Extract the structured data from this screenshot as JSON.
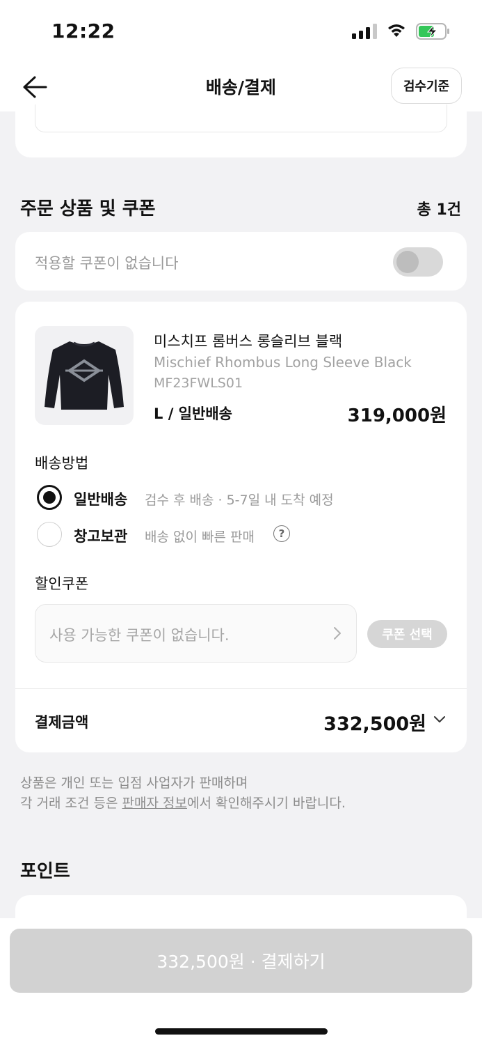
{
  "status_bar": {
    "time": "12:22"
  },
  "nav": {
    "title": "배송/결제",
    "criteria_button": "검수기준"
  },
  "order_section": {
    "title": "주문 상품 및 쿠폰",
    "count": "총 1건"
  },
  "coupon_toggle": {
    "text": "적용할 쿠폰이 없습니다",
    "enabled": false
  },
  "product": {
    "name_ko": "미스치프 롬버스 롱슬리브 블랙",
    "name_en": "Mischief Rhombus Long Sleeve Black",
    "code": "MF23FWLS01",
    "option": "L / 일반배송",
    "price": "319,000원"
  },
  "shipping": {
    "label": "배송방법",
    "options": [
      {
        "name": "일반배송",
        "desc": "검수 후 배송 · 5-7일 내 도착 예정",
        "selected": true
      },
      {
        "name": "창고보관",
        "desc": "배송 없이 빠른 판매",
        "selected": false,
        "help": "?"
      }
    ]
  },
  "discount": {
    "label": "할인쿠폰",
    "placeholder": "사용 가능한 쿠폰이 없습니다.",
    "button": "쿠폰 선택"
  },
  "payment": {
    "label": "결제금액",
    "amount": "332,500원"
  },
  "notice": {
    "line1": "상품은 개인 또는 입점 사업자가 판매하며",
    "line2_prefix": "각 거래 조건 등은 ",
    "line2_link": "판매자 정보",
    "line2_suffix": "에서 확인해주시기 바랍니다."
  },
  "points_section": {
    "title": "포인트"
  },
  "pay_button": {
    "label": "332,500원 · 결제하기"
  },
  "colors": {
    "background": "#f2f2f4",
    "disabled": "#d2d2d2",
    "text": "#111111",
    "muted": "#9a9a9a"
  }
}
